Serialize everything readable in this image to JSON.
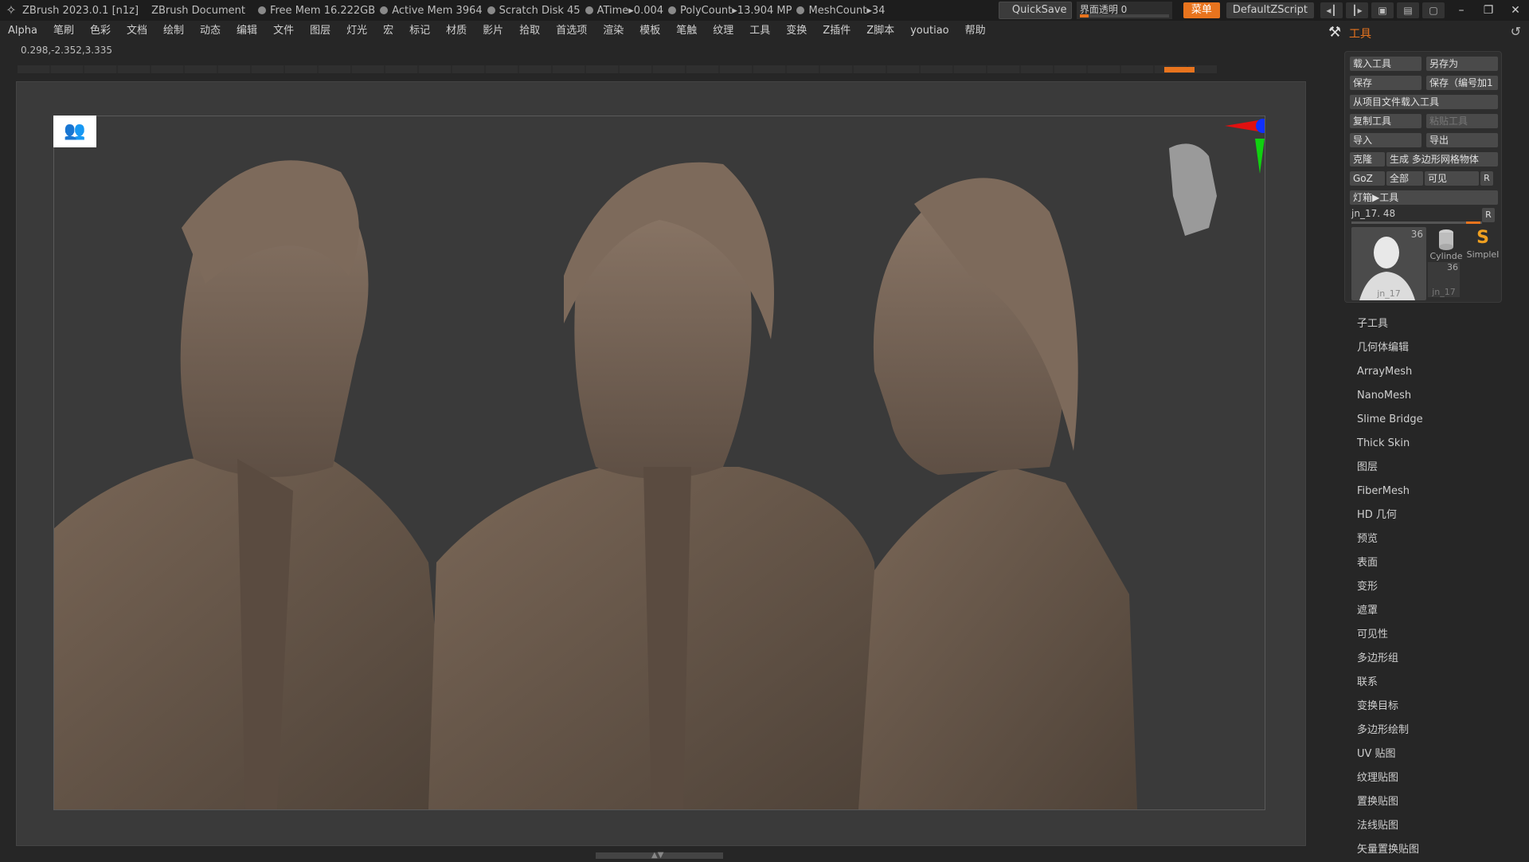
{
  "titlebar": {
    "app_title": "ZBrush 2023.0.1 [n1z]",
    "document": "ZBrush Document",
    "stats": [
      {
        "label": "Free Mem 16.222GB"
      },
      {
        "label": "Active Mem 3964"
      },
      {
        "label": "Scratch Disk 45"
      },
      {
        "label": "ATime▸0.004"
      },
      {
        "label": "PolyCount▸13.904 MP"
      },
      {
        "label": "MeshCount▸34"
      }
    ],
    "quicksave": "QuickSave",
    "opacity_label": "界面透明 0",
    "opacity_value": 0.1,
    "menu_button": "菜单",
    "script_button": "DefaultZScript",
    "accent_color": "#e8741e"
  },
  "menubar": {
    "items": [
      "Alpha",
      "笔刷",
      "色彩",
      "文档",
      "绘制",
      "动态",
      "编辑",
      "文件",
      "图层",
      "灯光",
      "宏",
      "标记",
      "材质",
      "影片",
      "拾取",
      "首选项",
      "渲染",
      "模板",
      "笔触",
      "纹理",
      "工具",
      "变换",
      "Z插件",
      "Z脚本",
      "youtiao",
      "帮助"
    ]
  },
  "coords": "0.298,-2.352,3.335",
  "tool_palette": {
    "title": "工具",
    "buttons": {
      "load_tool": "载入工具",
      "save_as": "另存为",
      "save": "保存",
      "save_inc": "保存（编号加1",
      "load_from_project": "从项目文件载入工具",
      "copy_tool": "复制工具",
      "paste_tool": "粘贴工具",
      "import": "导入",
      "export": "导出",
      "clone": "克隆",
      "make_polymesh": "生成 多边形网格物体",
      "goz": "GoZ",
      "all": "全部",
      "visible": "可见",
      "r": "R",
      "lightbox": "灯箱▶工具"
    },
    "current_tool_label": "jn_17. 48",
    "current_tool_value": 0.9,
    "thumbs": {
      "main_count": "36",
      "main_name": "jn_17",
      "cylinder": "Cylinde",
      "simple": "SimpleI",
      "small_count": "36",
      "small_name": "jn_17"
    },
    "subpalettes": [
      "子工具",
      "几何体编辑",
      "ArrayMesh",
      "NanoMesh",
      "Slime Bridge",
      "Thick Skin",
      "图层",
      "FiberMesh",
      "HD 几何",
      "预览",
      "表面",
      "变形",
      "遮罩",
      "可见性",
      "多边形组",
      "联系",
      "变换目标",
      "多边形绘制",
      "UV 贴图",
      "纹理贴图",
      "置换贴图",
      "法线贴图",
      "矢量置换贴图"
    ]
  }
}
